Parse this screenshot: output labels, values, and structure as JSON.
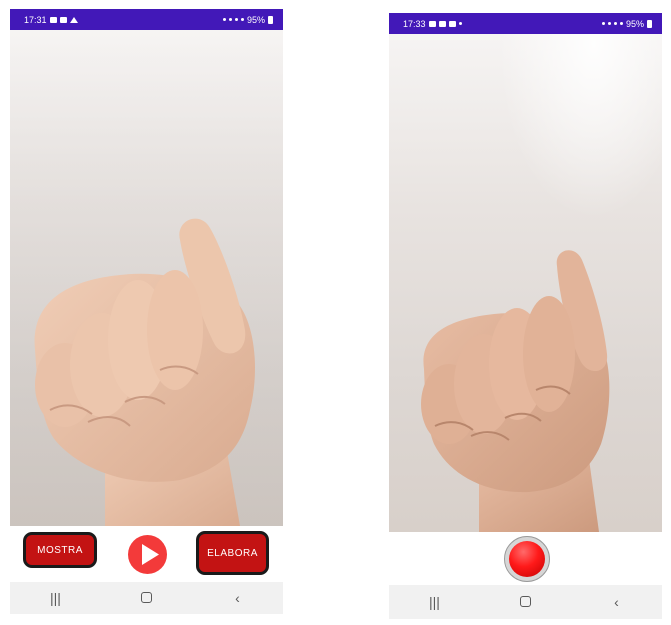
{
  "left_screen": {
    "status": {
      "time": "17:31",
      "battery": "95%"
    },
    "buttons": {
      "mostra_label": "MOSTRA",
      "elabora_label": "ELABORA"
    },
    "nav": {
      "recents": "|||",
      "back": "‹"
    }
  },
  "right_screen": {
    "status": {
      "time": "17:33",
      "battery": "95%"
    },
    "nav": {
      "recents": "|||",
      "back": "‹"
    }
  },
  "icons": {
    "play": "play-icon",
    "record": "record-icon",
    "home": "home-icon"
  },
  "colors": {
    "status_bar": "#4218b8",
    "action_button": "#c31313",
    "play_button": "#f33a3a",
    "record_button": "#ff1a1a"
  }
}
